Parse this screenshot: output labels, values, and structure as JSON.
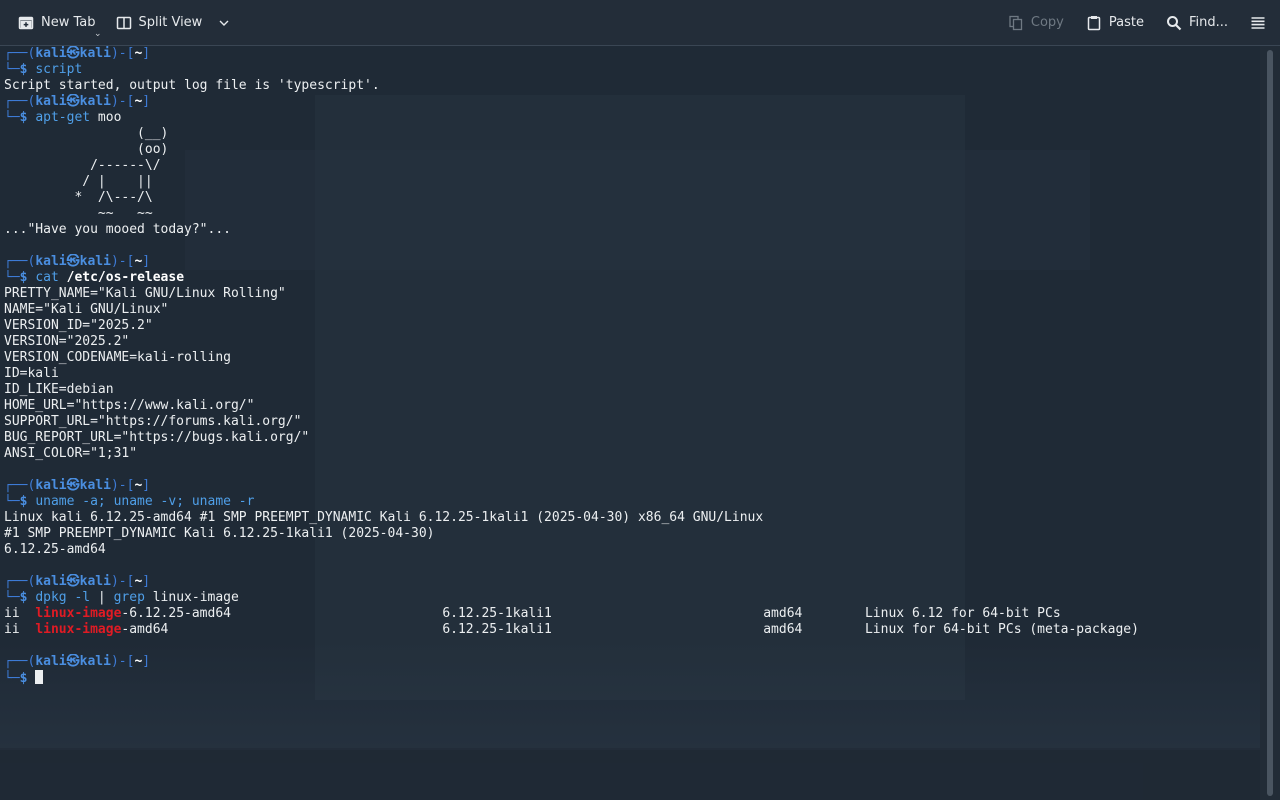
{
  "toolbar": {
    "new_tab": "New Tab",
    "split_view": "Split View",
    "copy": "Copy",
    "paste": "Paste",
    "find": "Find..."
  },
  "prompt": {
    "user": "kali",
    "host": "kali",
    "at_symbol": "㉿",
    "dir": "~",
    "symbol": "$"
  },
  "blocks": [
    {
      "type": "command",
      "cmd": "script",
      "args": "",
      "output": [
        "Script started, output log file is 'typescript'."
      ]
    },
    {
      "type": "command",
      "cmd": "apt-get",
      "args": "moo",
      "output": [
        "                 (__)",
        "                 (oo)",
        "           /------\\/",
        "          / |    ||",
        "         *  /\\---/\\",
        "            ~~   ~~",
        "...\"Have you mooed today?\"...",
        ""
      ]
    },
    {
      "type": "command",
      "cmd": "cat",
      "args_bold": "/etc/os-release",
      "output": [
        "PRETTY_NAME=\"Kali GNU/Linux Rolling\"",
        "NAME=\"Kali GNU/Linux\"",
        "VERSION_ID=\"2025.2\"",
        "VERSION=\"2025.2\"",
        "VERSION_CODENAME=kali-rolling",
        "ID=kali",
        "ID_LIKE=debian",
        "HOME_URL=\"https://www.kali.org/\"",
        "SUPPORT_URL=\"https://forums.kali.org/\"",
        "BUG_REPORT_URL=\"https://bugs.kali.org/\"",
        "ANSI_COLOR=\"1;31\"",
        ""
      ]
    },
    {
      "type": "command",
      "cmd": "uname -a; uname -v; uname -r",
      "args": "",
      "output": [
        "Linux kali 6.12.25-amd64 #1 SMP PREEMPT_DYNAMIC Kali 6.12.25-1kali1 (2025-04-30) x86_64 GNU/Linux",
        "#1 SMP PREEMPT_DYNAMIC Kali 6.12.25-1kali1 (2025-04-30)",
        "6.12.25-amd64",
        ""
      ]
    },
    {
      "type": "dpkg",
      "cmd": "dpkg -l",
      "pipe": " | ",
      "cmd2": "grep",
      "args": "linux-image",
      "rows": [
        {
          "status": "ii",
          "match": "linux-image",
          "rest": "-6.12.25-amd64",
          "version": "6.12.25-1kali1",
          "arch": "amd64",
          "desc": "Linux 6.12 for 64-bit PCs"
        },
        {
          "status": "ii",
          "match": "linux-image",
          "rest": "-amd64",
          "version": "6.12.25-1kali1",
          "arch": "amd64",
          "desc": "Linux for 64-bit PCs (meta-package)"
        }
      ]
    }
  ],
  "colors": {
    "background": "#1f2a36",
    "prompt_box": "#3d7bd6",
    "prompt_user": "#4a8ee0",
    "command": "#4f9fe8",
    "grep_match": "#e01b24",
    "text": "#eceff1"
  },
  "icons": {
    "new_tab": "new-tab-icon",
    "split_view": "split-view-icon",
    "copy": "copy-icon",
    "paste": "paste-icon",
    "find": "search-icon",
    "menu": "hamburger-menu-icon"
  }
}
